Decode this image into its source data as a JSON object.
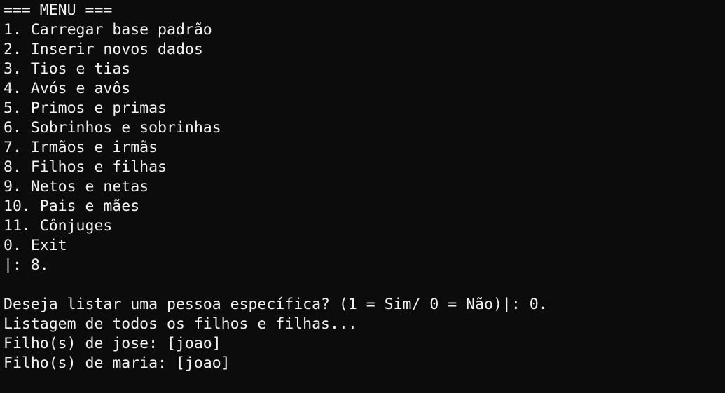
{
  "terminal": {
    "menu_header": "=== MENU ===",
    "menu_items": [
      "1. Carregar base padrão",
      "2. Inserir novos dados",
      "3. Tios e tias",
      "4. Avós e avôs",
      "5. Primos e primas",
      "6. Sobrinhos e sobrinhas",
      "7. Irmãos e irmãs",
      "8. Filhos e filhas",
      "9. Netos e netas",
      "10. Pais e mães",
      "11. Cônjuges",
      "0. Exit"
    ],
    "menu_prompt": "|: 8.",
    "question": "Deseja listar uma pessoa específica? (1 = Sim/ 0 = Não)|: 0.",
    "listing_header": "Listagem de todos os filhos e filhas...",
    "results": [
      "Filho(s) de jose: [joao]",
      "Filho(s) de maria: [joao]"
    ]
  },
  "colors": {
    "background": "#0c0c0c",
    "foreground": "#f2f2f2"
  }
}
